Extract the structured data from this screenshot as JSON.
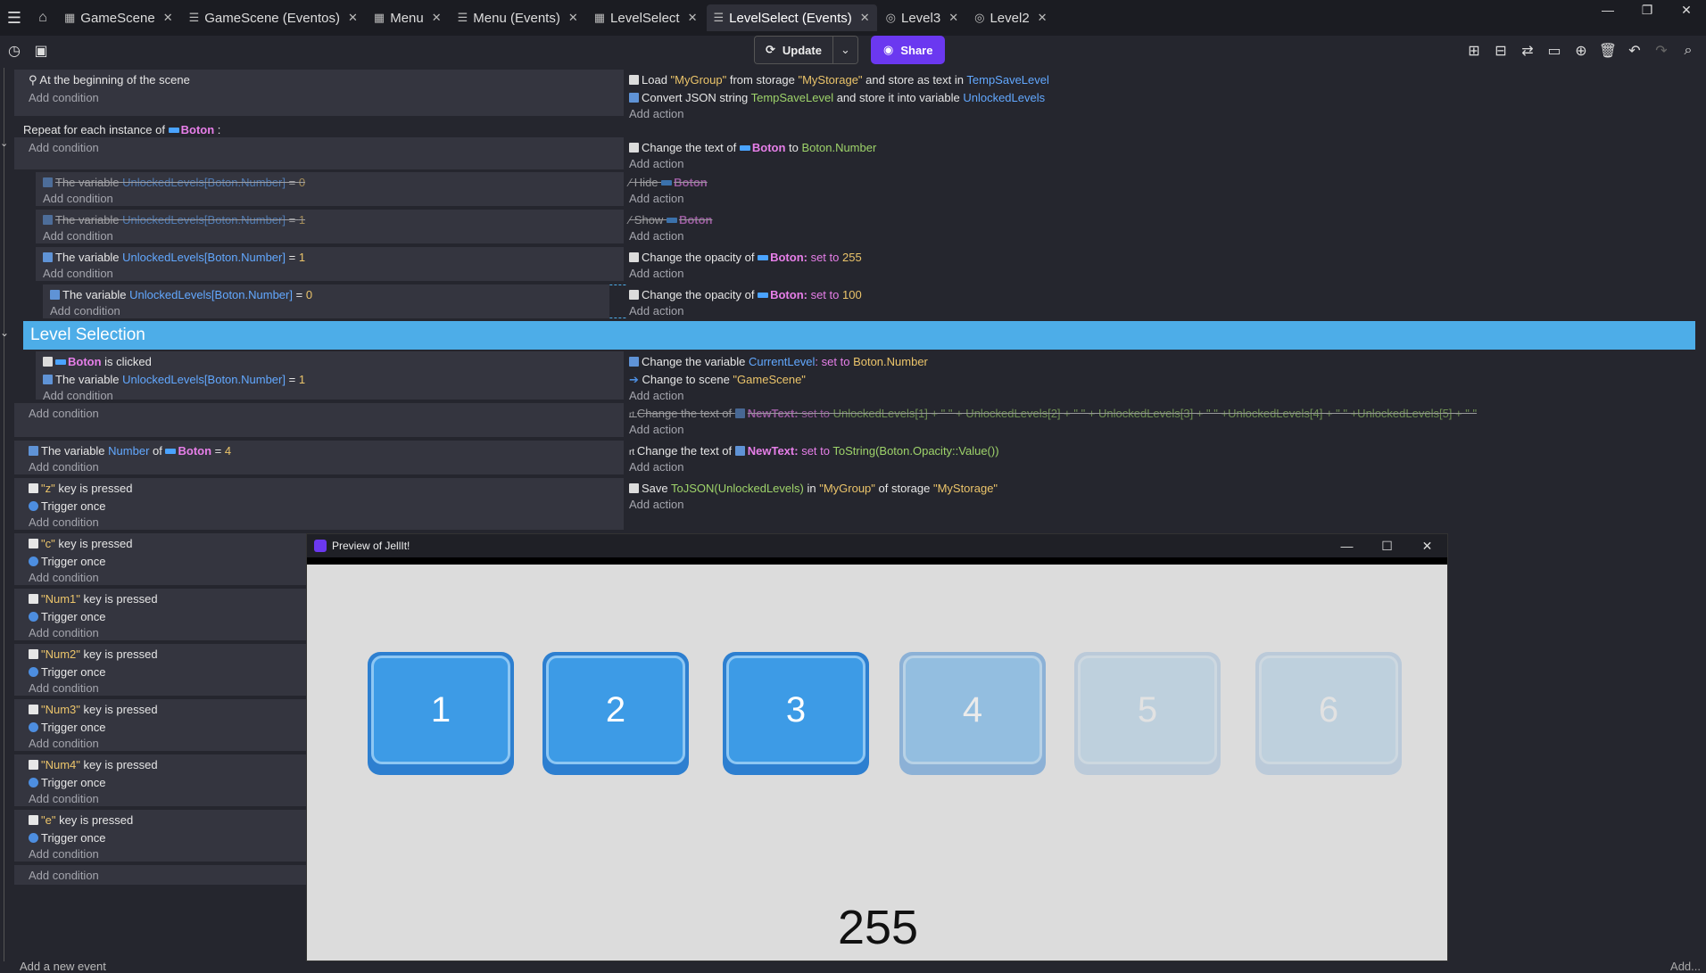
{
  "tabs": [
    {
      "label": "GameScene",
      "icon": "scene-icon"
    },
    {
      "label": "GameScene (Eventos)",
      "icon": "events-icon"
    },
    {
      "label": "Menu",
      "icon": "scene-icon"
    },
    {
      "label": "Menu (Events)",
      "icon": "events-icon"
    },
    {
      "label": "LevelSelect",
      "icon": "scene-icon"
    },
    {
      "label": "LevelSelect (Events)",
      "icon": "events-icon",
      "active": true
    },
    {
      "label": "Level3",
      "icon": "extension-icon"
    },
    {
      "label": "Level2",
      "icon": "extension-icon"
    }
  ],
  "toolbar": {
    "update_label": "Update",
    "share_label": "Share"
  },
  "common": {
    "add_condition": "Add condition",
    "add_action": "Add action",
    "add_new_event": "Add a new event",
    "add_right": "Add..."
  },
  "events": {
    "e1": {
      "c1": "At the beginning of the scene",
      "a1_pre": "Load ",
      "a1_s1": "\"MyGroup\"",
      "a1_mid": " from storage ",
      "a1_s2": "\"MyStorage\"",
      "a1_mid2": " and store as text in ",
      "a1_var": "TempSaveLevel",
      "a2_pre": "Convert JSON string ",
      "a2_e": "TempSaveLevel",
      "a2_mid": " and store it into variable ",
      "a2_var": "UnlockedLevels"
    },
    "repeat": {
      "pre": "Repeat for each instance of ",
      "obj": "Boton",
      "post": " :",
      "a1_pre": "Change the text of ",
      "a1_obj": "Boton",
      "a1_mid": " to ",
      "a1_e": "Boton.Number"
    },
    "s1": {
      "c_pre": "The variable ",
      "c_var": "UnlockedLevels[Boton.Number]",
      "c_op": " = ",
      "c_val": "0",
      "a_pre": "Hide ",
      "a_obj": "Boton"
    },
    "s2": {
      "c_pre": "The variable ",
      "c_var": "UnlockedLevels[Boton.Number]",
      "c_op": " = ",
      "c_val": "1",
      "a_pre": "Show ",
      "a_obj": "Boton"
    },
    "s3": {
      "c_pre": "The variable ",
      "c_var": "UnlockedLevels[Boton.Number]",
      "c_op": " = ",
      "c_val": "1",
      "a_pre": "Change the opacity of ",
      "a_obj": "Boton:",
      "a_kw": " set to ",
      "a_val": "255"
    },
    "s4": {
      "c_pre": "The variable ",
      "c_var": "UnlockedLevels[Boton.Number]",
      "c_op": " = ",
      "c_val": "0",
      "a_pre": "Change the opacity of ",
      "a_obj": "Boton:",
      "a_kw": " set to ",
      "a_val": "100"
    },
    "group": {
      "title": "Level Selection"
    },
    "g1": {
      "c1_obj": "Boton",
      "c1_post": " is clicked",
      "c2_pre": "The variable ",
      "c2_var": "UnlockedLevels[Boton.Number]",
      "c2_op": " = ",
      "c2_val": "1",
      "a1_pre": "Change the variable ",
      "a1_var": "CurrentLevel",
      "a1_kw": ": set to ",
      "a1_e": "Boton.Number",
      "a2_pre": "Change to scene ",
      "a2_s": "\"GameScene\""
    },
    "g2": {
      "a_pre": "Change the text of ",
      "a_obj": "NewText:",
      "a_kw": " set to ",
      "a_e": "UnlockedLevels[1] + \" \" + UnlockedLevels[2] + \" \" + UnlockedLevels[3] + \" \" +UnlockedLevels[4] + \" \" +UnlockedLevels[5] + \" \""
    },
    "g3": {
      "c_pre": "The variable ",
      "c_var": "Number",
      "c_mid": " of ",
      "c_obj": "Boton",
      "c_op": " = ",
      "c_val": "4",
      "a_pre": "Change the text of ",
      "a_obj": "NewText:",
      "a_kw": " set to ",
      "a_e": "ToString(Boton.Opacity::Value())"
    },
    "keys": [
      {
        "key": "\"z\"",
        "post": " key is pressed",
        "trigger": "Trigger once",
        "a_pre": "Save ",
        "a_e": "ToJSON(UnlockedLevels)",
        "a_mid": " in ",
        "a_s1": "\"MyGroup\"",
        "a_mid2": " of storage ",
        "a_s2": "\"MyStorage\""
      },
      {
        "key": "\"c\"",
        "post": " key is pressed",
        "trigger": "Trigger once"
      },
      {
        "key": "\"Num1\"",
        "post": " key is pressed",
        "trigger": "Trigger once"
      },
      {
        "key": "\"Num2\"",
        "post": " key is pressed",
        "trigger": "Trigger once"
      },
      {
        "key": "\"Num3\"",
        "post": " key is pressed",
        "trigger": "Trigger once"
      },
      {
        "key": "\"Num4\"",
        "post": " key is pressed",
        "trigger": "Trigger once"
      },
      {
        "key": "\"e\"",
        "post": " key is pressed",
        "trigger": "Trigger once"
      }
    ]
  },
  "preview": {
    "title": "Preview of JellIt!",
    "buttons": [
      "1",
      "2",
      "3",
      "4",
      "5",
      "6"
    ],
    "button_opacity_levels": [
      255,
      255,
      255,
      100,
      100,
      100
    ],
    "display_number": "255"
  }
}
